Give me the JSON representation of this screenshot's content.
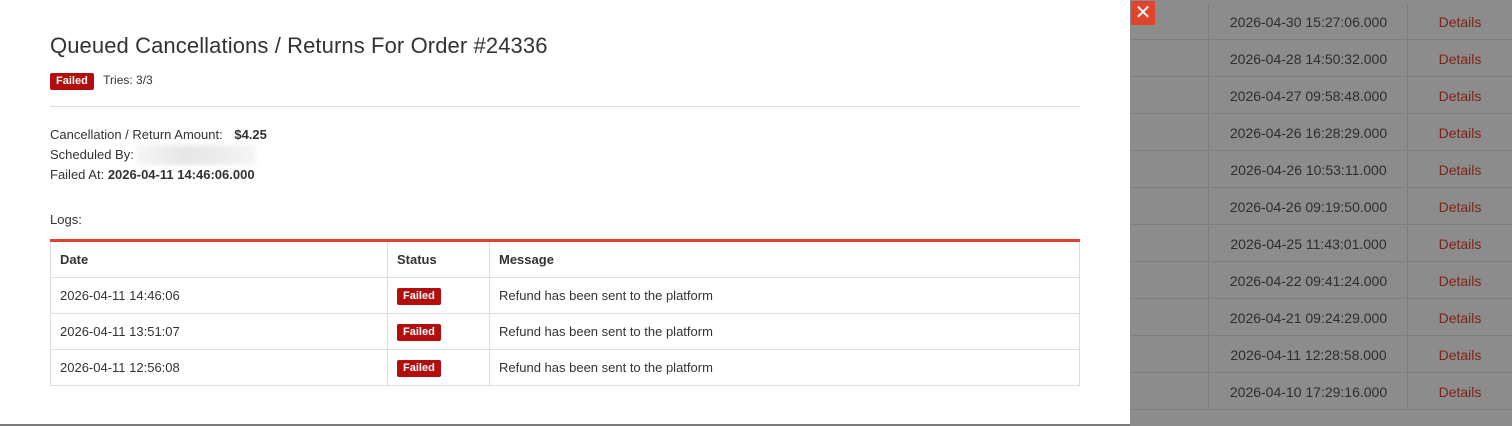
{
  "modal": {
    "title": "Queued Cancellations / Returns For Order #24336",
    "status_badge": "Failed",
    "tries": "Tries: 3/3",
    "amount_label": "Cancellation / Return Amount:",
    "amount_value": "$4.25",
    "scheduled_by_label": "Scheduled By:",
    "failed_at_label": "Failed At:",
    "failed_at_value": "2026-04-11 14:46:06.000",
    "logs_label": "Logs:",
    "close_icon": "close-icon",
    "logs": {
      "headers": [
        "Date",
        "Status",
        "Message"
      ],
      "rows": [
        {
          "date": "2026-04-11 14:46:06",
          "status": "Failed",
          "message": "Refund has been sent to the platform"
        },
        {
          "date": "2026-04-11 13:51:07",
          "status": "Failed",
          "message": "Refund has been sent to the platform"
        },
        {
          "date": "2026-04-11 12:56:08",
          "status": "Failed",
          "message": "Refund has been sent to the platform"
        }
      ]
    }
  },
  "background_table": {
    "link_label": "Details",
    "rows": [
      "2026-04-30 15:27:06.000",
      "2026-04-28 14:50:32.000",
      "2026-04-27 09:58:48.000",
      "2026-04-26 16:28:29.000",
      "2026-04-26 10:53:11.000",
      "2026-04-26 09:19:50.000",
      "2026-04-25 11:43:01.000",
      "2026-04-22 09:41:24.000",
      "2026-04-21 09:24:29.000",
      "2026-04-11 12:28:58.000",
      "2026-04-10 17:29:16.000"
    ]
  },
  "colors": {
    "accent": "#e0442d",
    "failed_badge": "#b40d0d",
    "overlay": "#8c8c8c"
  }
}
